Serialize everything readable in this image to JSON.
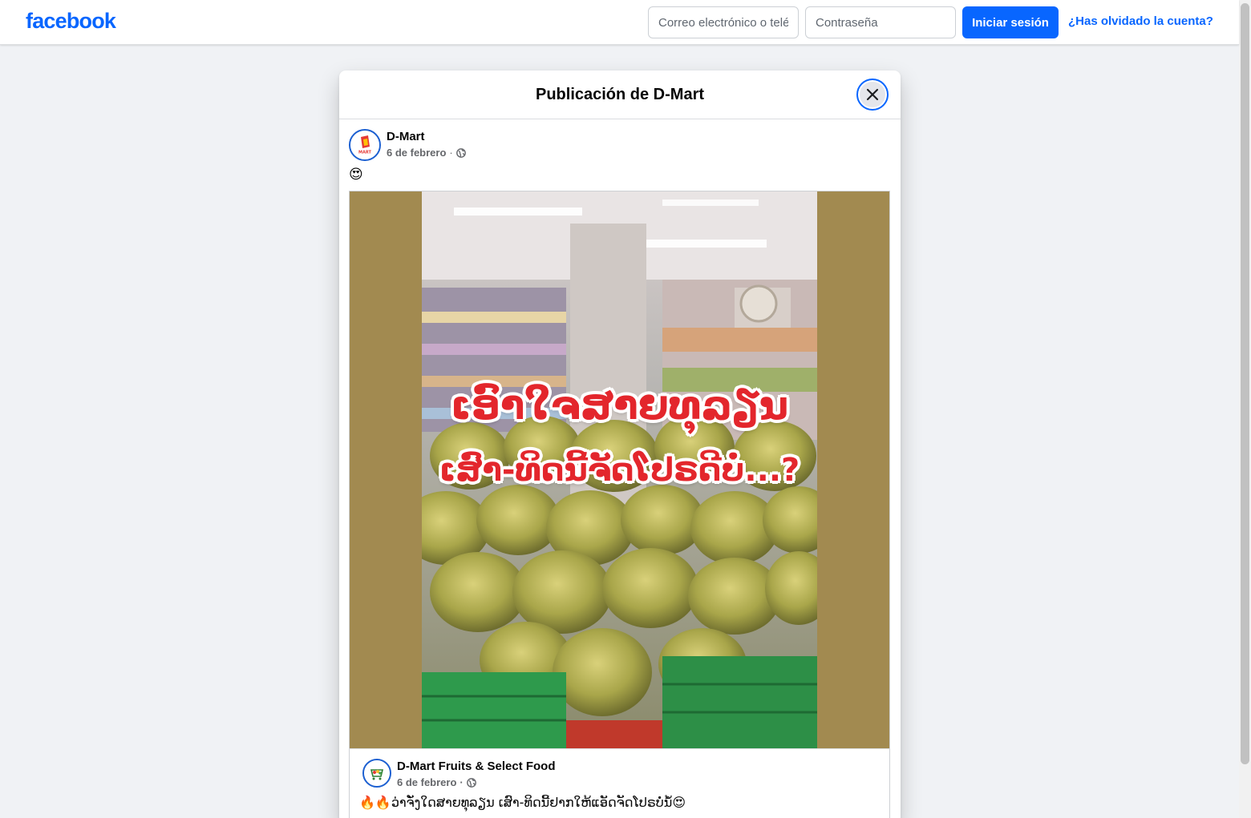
{
  "brand": {
    "name": "facebook",
    "color": "#0866ff"
  },
  "login": {
    "email_placeholder": "Correo electrónico o teléfono",
    "password_placeholder": "Contraseña",
    "login_label": "Iniciar sesión",
    "forgot_label": "¿Has olvidado la cuenta?"
  },
  "modal": {
    "title": "Publicación de D-Mart",
    "close_icon": "close-icon"
  },
  "post": {
    "author": "D-Mart",
    "date": "6 de febrero",
    "separator": "·",
    "privacy_icon": "globe-icon",
    "text": "😍",
    "image": {
      "overlay_line1": "ເອົາໃຈສາຍທຸລຽນ",
      "overlay_line2": "ເສົາ-ທິດນີ້ຈັດໂປຣດີບໍ່...?"
    }
  },
  "shared_post": {
    "author": "D-Mart Fruits & Select Food",
    "date": "6 de febrero",
    "separator": "·",
    "privacy_icon": "globe-icon",
    "text": "🔥🔥ວ່າຈັ່ງໃດສາຍທຸລຽນ ເສົາ-ທິດນີ້ຢາກໃຫ້ແອັດຈັດໂປຣບໍ່ນໍ້😍"
  }
}
